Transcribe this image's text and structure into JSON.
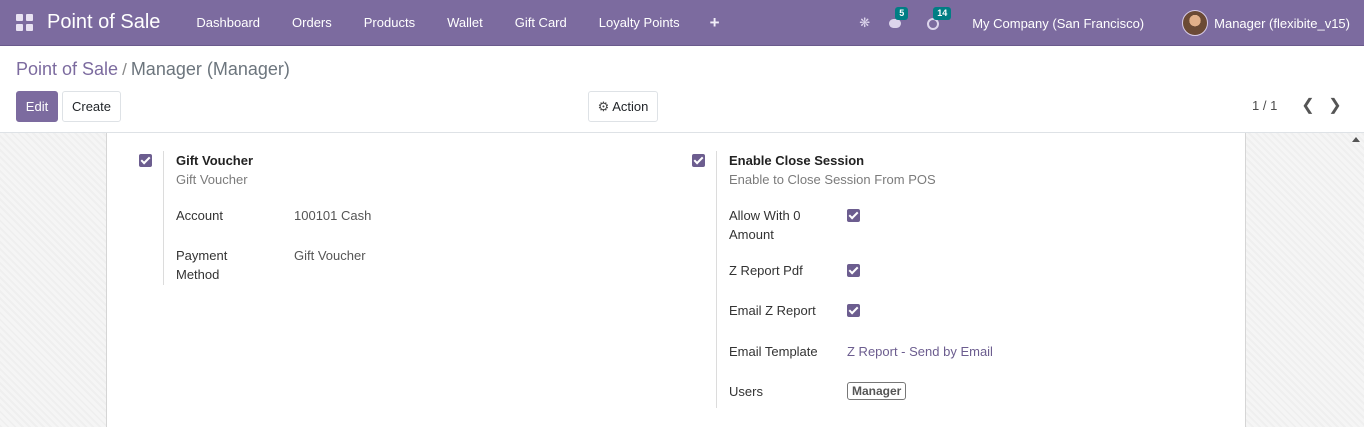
{
  "navbar": {
    "brand": "Point of Sale",
    "menu": [
      "Dashboard",
      "Orders",
      "Products",
      "Wallet",
      "Gift Card",
      "Loyalty Points"
    ],
    "plus": "+",
    "messages_badge": "5",
    "activities_badge": "14",
    "company": "My Company (San Francisco)",
    "user": "Manager (flexibite_v15)"
  },
  "control_panel": {
    "breadcrumb_parent": "Point of Sale",
    "breadcrumb_sep": "/",
    "breadcrumb_current": "Manager (Manager)",
    "edit_label": "Edit",
    "create_label": "Create",
    "action_label": "Action",
    "pager": "1 / 1"
  },
  "form": {
    "left": {
      "title": "Gift Voucher",
      "subtitle": "Gift Voucher",
      "checked": true,
      "fields": [
        {
          "label": "Account",
          "value": "100101 Cash"
        },
        {
          "label": "Payment Method",
          "value": "Gift Voucher"
        }
      ]
    },
    "right": {
      "title": "Enable Close Session",
      "subtitle": "Enable to Close Session From POS",
      "checked": true,
      "fields": [
        {
          "label": "Allow With 0 Amount",
          "checked": true
        },
        {
          "label": "Z Report Pdf",
          "checked": true
        },
        {
          "label": "Email Z Report",
          "checked": true
        },
        {
          "label": "Email Template",
          "value": "Z Report - Send by Email"
        },
        {
          "label": "Users",
          "value": "Manager"
        }
      ]
    }
  },
  "colors": {
    "navbar": "#7c6b9f",
    "primary": "#7c6b9f",
    "badge": "#017e84",
    "checkbox": "#6c5d8f"
  }
}
